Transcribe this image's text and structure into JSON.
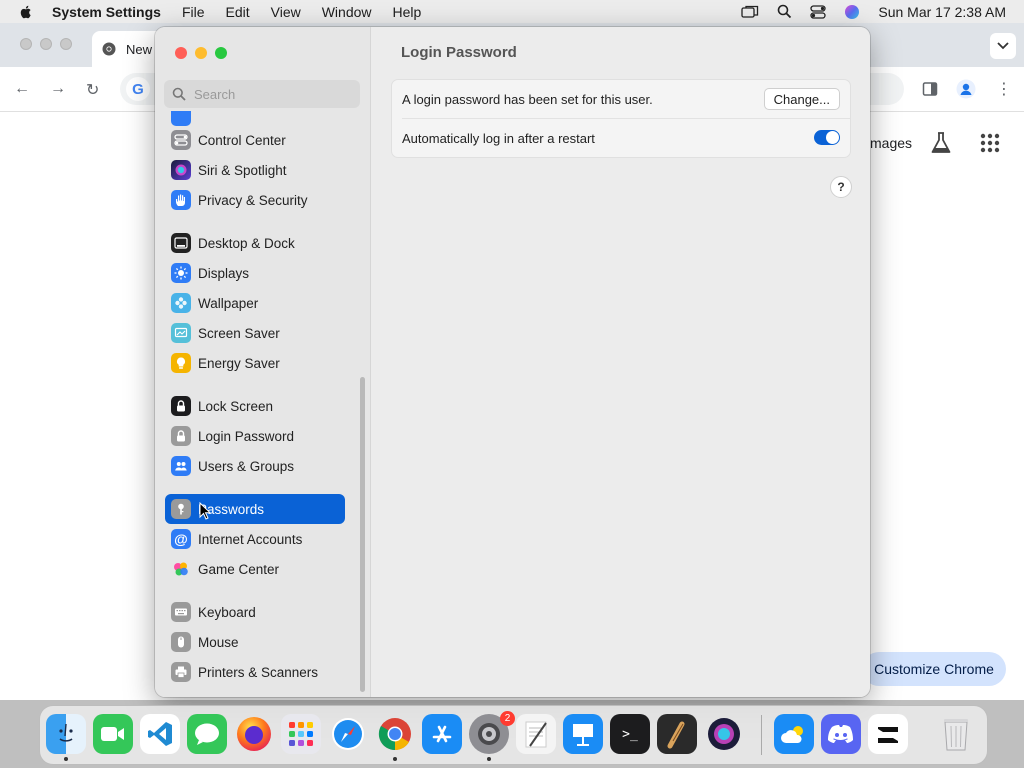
{
  "menubar": {
    "app_name": "System Settings",
    "items": [
      "File",
      "Edit",
      "View",
      "Window",
      "Help"
    ],
    "clock": "Sun Mar 17  2:38 AM"
  },
  "chrome": {
    "tab_title": "New T",
    "images_link": "mages",
    "customize_label": "Customize Chrome"
  },
  "settings": {
    "search_placeholder": "Search",
    "sidebar": [
      {
        "label": "Control Center",
        "icon": "control-center-icon",
        "color": "#8e8e93"
      },
      {
        "label": "Siri & Spotlight",
        "icon": "siri-icon",
        "color": "#5b3fd6"
      },
      {
        "label": "Privacy & Security",
        "icon": "hand-icon",
        "color": "#2f7cf6"
      },
      {
        "label": "Desktop & Dock",
        "icon": "dock-icon",
        "color": "#222222"
      },
      {
        "label": "Displays",
        "icon": "sun-icon",
        "color": "#2f7cf6"
      },
      {
        "label": "Wallpaper",
        "icon": "wallpaper-icon",
        "color": "#49b3e8"
      },
      {
        "label": "Screen Saver",
        "icon": "screen-saver-icon",
        "color": "#55c0d9"
      },
      {
        "label": "Energy Saver",
        "icon": "bulb-icon",
        "color": "#f5b400"
      },
      {
        "label": "Lock Screen",
        "icon": "lock-icon",
        "color": "#1c1c1e"
      },
      {
        "label": "Login Password",
        "icon": "lock-icon",
        "color": "#9a9a9a"
      },
      {
        "label": "Users & Groups",
        "icon": "users-icon",
        "color": "#2f7cf6"
      },
      {
        "label": "Passwords",
        "icon": "key-icon",
        "color": "#9a9a9a"
      },
      {
        "label": "Internet Accounts",
        "icon": "at-icon",
        "color": "#2f7cf6"
      },
      {
        "label": "Game Center",
        "icon": "game-center-icon",
        "color": "#ffffff"
      },
      {
        "label": "Keyboard",
        "icon": "keyboard-icon",
        "color": "#9a9a9a"
      },
      {
        "label": "Mouse",
        "icon": "mouse-icon",
        "color": "#9a9a9a"
      },
      {
        "label": "Printers & Scanners",
        "icon": "printer-icon",
        "color": "#9a9a9a"
      }
    ],
    "selected_item": "Passwords",
    "content": {
      "title": "Login Password",
      "row1_label": "A login password has been set for this user.",
      "change_button": "Change...",
      "row2_label": "Automatically log in after a restart",
      "auto_login_enabled": true,
      "help": "?"
    }
  },
  "dock": {
    "apps": [
      "finder",
      "facetime",
      "vscode",
      "messages",
      "firefox",
      "launchpad",
      "safari",
      "chrome",
      "app-store",
      "system-settings",
      "textedit",
      "keynote",
      "terminal",
      "instruments",
      "siri",
      "weather",
      "discord",
      "capcut",
      "trash"
    ],
    "system_settings_badge": "2"
  },
  "colors": {
    "accent": "#0a62d6",
    "window_bg": "#ececec"
  }
}
